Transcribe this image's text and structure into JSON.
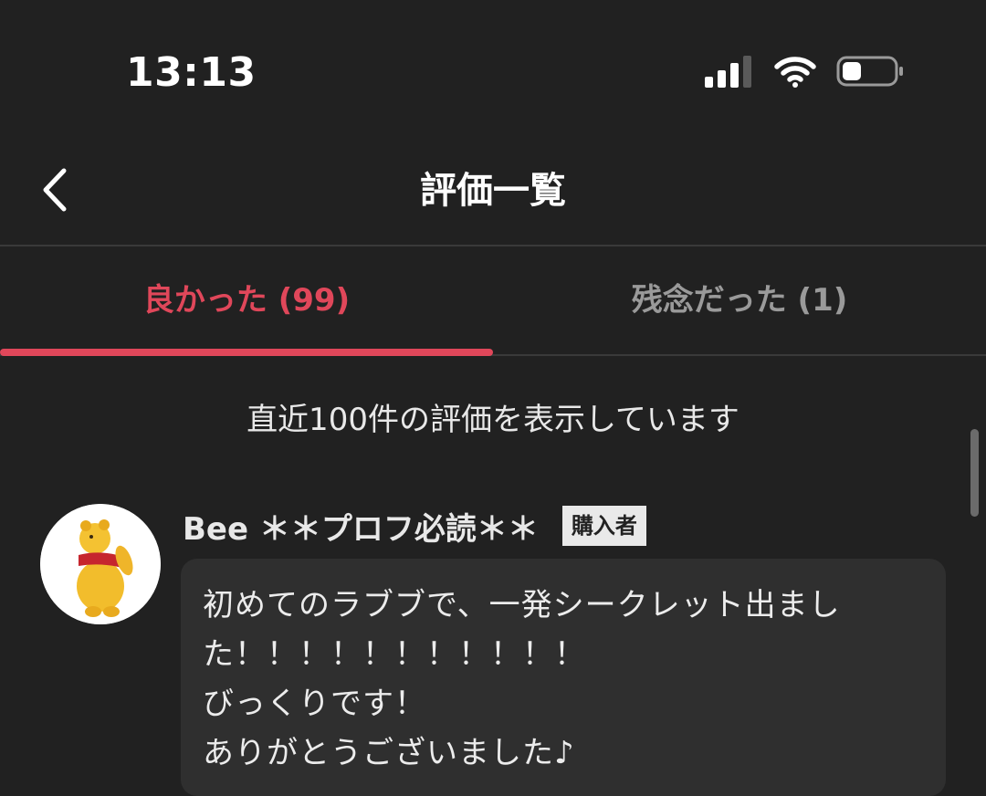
{
  "status_bar": {
    "time": "13:13",
    "icons": [
      "cellular-signal-icon",
      "wifi-icon",
      "battery-icon"
    ]
  },
  "nav": {
    "back_icon": "chevron-left-icon",
    "title": "評価一覧"
  },
  "tabs": [
    {
      "label": "良かった (99)",
      "active": true
    },
    {
      "label": "残念だった (1)",
      "active": false
    }
  ],
  "notice": "直近100件の評価を表示しています",
  "reviews": [
    {
      "avatar": "bear-avatar",
      "username": "Bee ＊＊プロフ必読＊＊",
      "badge": "購入者",
      "text": "初めてのラブブで、一発シークレット出ました！！！！！！！！！！！\nびっくりです！\nありがとうございました♪"
    }
  ],
  "colors": {
    "background": "#212121",
    "accent": "#e0475a",
    "inactive_tab": "#9a9a9a",
    "bubble": "#2f2f2f",
    "badge_bg": "#e9e9e9"
  }
}
